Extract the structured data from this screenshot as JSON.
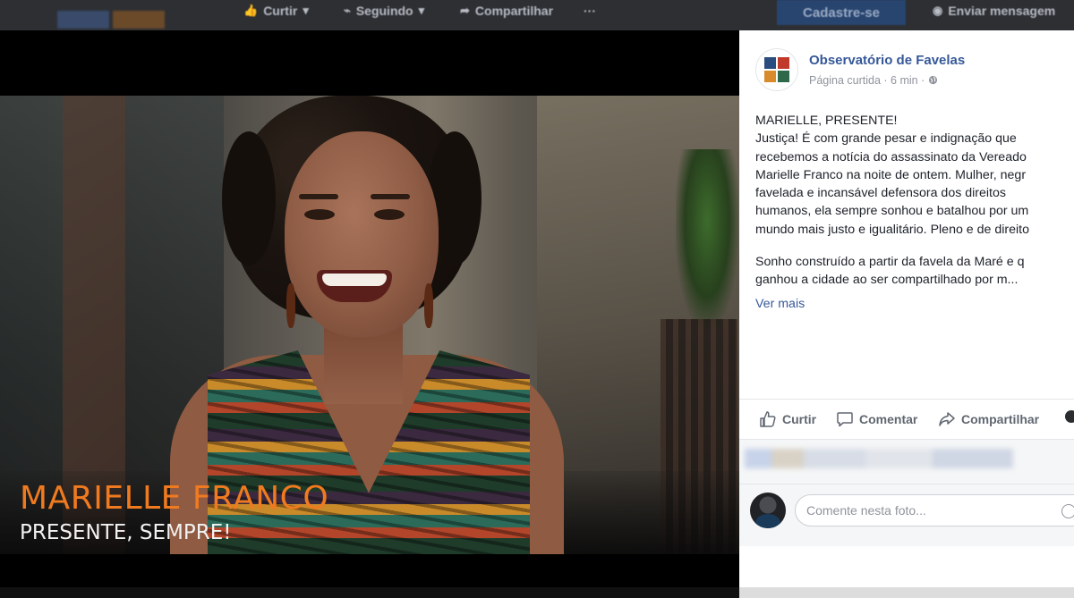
{
  "topbar": {
    "like_label": "Curtir",
    "following_label": "Seguindo",
    "share_label": "Compartilhar",
    "more_label": "···",
    "signup_label": "Cadastre-se",
    "message_label": "Enviar mensagem"
  },
  "photo": {
    "caption_name": "MARIELLE FRANCO",
    "caption_subtitle": "PRESENTE, SEMPRE!"
  },
  "post": {
    "page_name": "Observatório de Favelas",
    "meta_text": "Página curtida · 6 min · ",
    "globe_icon": "globe-icon",
    "text_lines": [
      "MARIELLE, PRESENTE!",
      "Justiça! É com grande pesar e indignação que",
      "recebemos a notícia do assassinato da Vereado",
      "Marielle Franco na noite de ontem. Mulher, negr",
      "favelada e incansável defensora dos direitos",
      "humanos, ela sempre sonhou e batalhou por um",
      "mundo mais justo e igualitário. Pleno e de direito"
    ],
    "text_lines_2": [
      "Sonho construído a partir da favela da Maré e q",
      "ganhou a cidade ao ser compartilhado por m..."
    ],
    "see_more": "Ver mais"
  },
  "actions": {
    "like": "Curtir",
    "comment": "Comentar",
    "share": "Compartilhar"
  },
  "comment": {
    "placeholder": "Comente nesta foto..."
  },
  "colors": {
    "link_blue": "#365899",
    "caption_orange": "#f07a1f",
    "meta_gray": "#90949c"
  }
}
